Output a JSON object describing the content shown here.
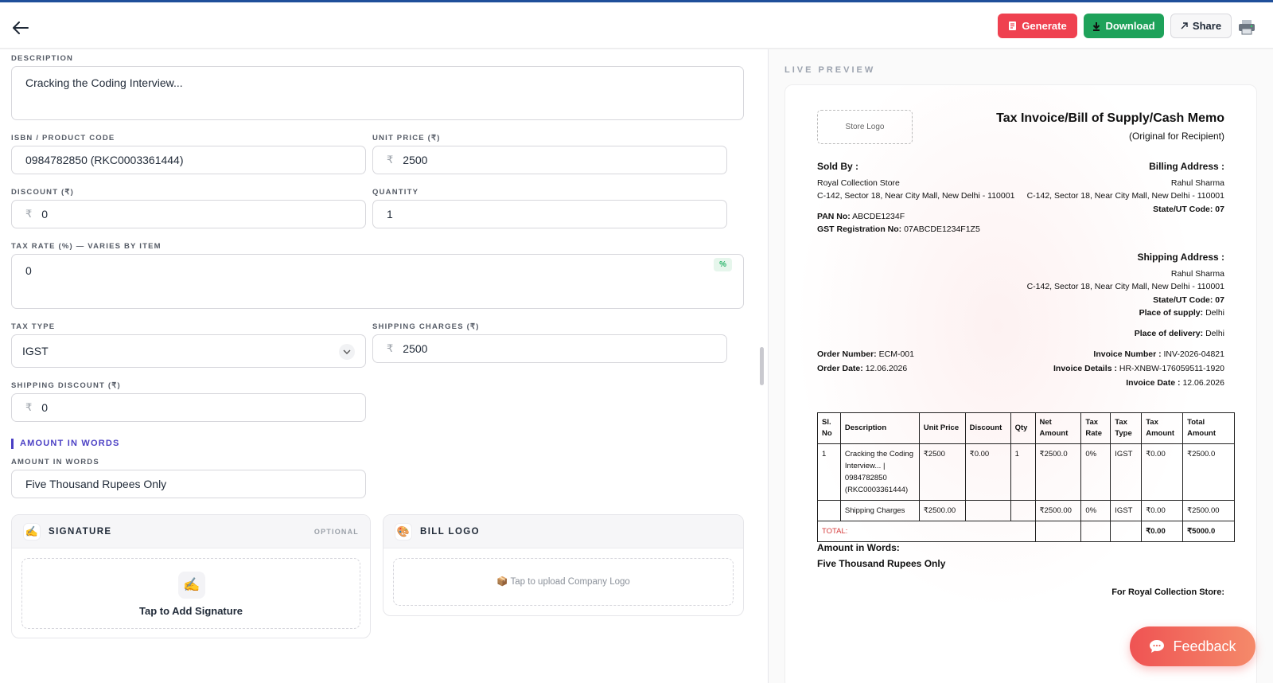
{
  "header": {
    "generate_label": "Generate",
    "download_label": "Download",
    "share_label": "Share"
  },
  "form": {
    "description": {
      "label": "DESCRIPTION",
      "value": "Cracking the Coding Interview..."
    },
    "isbn": {
      "label": "ISBN / PRODUCT CODE",
      "value": "0984782850 (RKC0003361444)"
    },
    "unit_price": {
      "label": "UNIT PRICE (₹)",
      "value": "2500",
      "currency": "₹"
    },
    "discount": {
      "label": "DISCOUNT (₹)",
      "value": "0",
      "currency": "₹"
    },
    "quantity": {
      "label": "QUANTITY",
      "value": "1"
    },
    "tax_rate": {
      "label": "TAX RATE (%) — VARIES BY ITEM",
      "value": "0",
      "badge": "%"
    },
    "tax_type": {
      "label": "TAX TYPE",
      "value": "IGST"
    },
    "shipping_charges": {
      "label": "SHIPPING CHARGES (₹)",
      "value": "2500",
      "currency": "₹"
    },
    "shipping_discount": {
      "label": "SHIPPING DISCOUNT (₹)",
      "value": "0",
      "currency": "₹"
    },
    "amount_words_section": "AMOUNT IN WORDS",
    "amount_words": {
      "label": "AMOUNT IN WORDS",
      "value": "Five Thousand  Rupees Only"
    }
  },
  "signature_card": {
    "title": "SIGNATURE",
    "optional": "OPTIONAL",
    "icon": "✍",
    "cta": "Tap to Add Signature"
  },
  "logo_card": {
    "title": "BILL LOGO",
    "icon": "🎨",
    "cta": "📦 Tap to upload Company Logo"
  },
  "preview": {
    "label": "LIVE PREVIEW",
    "store_logo": "Store Logo",
    "title": "Tax Invoice/Bill of Supply/Cash Memo",
    "subtitle": "(Original for Recipient)",
    "sold_by_label": "Sold By :",
    "store_name": "Royal Collection Store",
    "store_address": "C-142, Sector 18, Near City Mall, New Delhi - 110001",
    "pan_label": "PAN No:",
    "pan": "ABCDE1234F",
    "gst_label": "GST Registration No:",
    "gst": "07ABCDE1234F1Z5",
    "billing_label": "Billing Address :",
    "billing_name": "Rahul Sharma",
    "billing_address": "C-142, Sector 18, Near City Mall, New Delhi - 110001",
    "billing_state": "State/UT Code: 07",
    "shipping_label": "Shipping Address :",
    "shipping_name": "Rahul Sharma",
    "shipping_address": "C-142, Sector 18, Near City Mall, New Delhi - 110001",
    "shipping_state": "State/UT Code: 07",
    "place_supply_label": "Place of supply:",
    "place_supply": "Delhi",
    "place_delivery_label": "Place of delivery:",
    "place_delivery": "Delhi",
    "order_number_label": "Order Number:",
    "order_number": "ECM-001",
    "order_date_label": "Order Date:",
    "order_date": "12.06.2026",
    "invoice_number_label": "Invoice Number :",
    "invoice_number": "INV-2026-04821",
    "invoice_details_label": "Invoice Details :",
    "invoice_details": "HR-XNBW-176059511-1920",
    "invoice_date_label": "Invoice Date :",
    "invoice_date": "12.06.2026",
    "table": {
      "headers": [
        "Sl. No",
        "Description",
        "Unit Price",
        "Discount",
        "Qty",
        "Net Amount",
        "Tax Rate",
        "Tax Type",
        "Tax Amount",
        "Total Amount"
      ],
      "rows": [
        [
          "1",
          "Cracking the Coding Interview... | 0984782850 (RKC0003361444)",
          "₹2500",
          "₹0.00",
          "1",
          "₹2500.0",
          "0%",
          "IGST",
          "₹0.00",
          "₹2500.0"
        ],
        [
          "",
          "Shipping Charges",
          "₹2500.00",
          "",
          "",
          "₹2500.00",
          "0%",
          "IGST",
          "₹0.00",
          "₹2500.00"
        ]
      ],
      "total_label": "TOTAL:",
      "total_tax": "₹0.00",
      "total_amount": "₹5000.0"
    },
    "amount_words_label": "Amount in Words:",
    "amount_words": "Five Thousand Rupees Only",
    "for_store": "For Royal Collection Store:"
  },
  "feedback_label": "Feedback"
}
